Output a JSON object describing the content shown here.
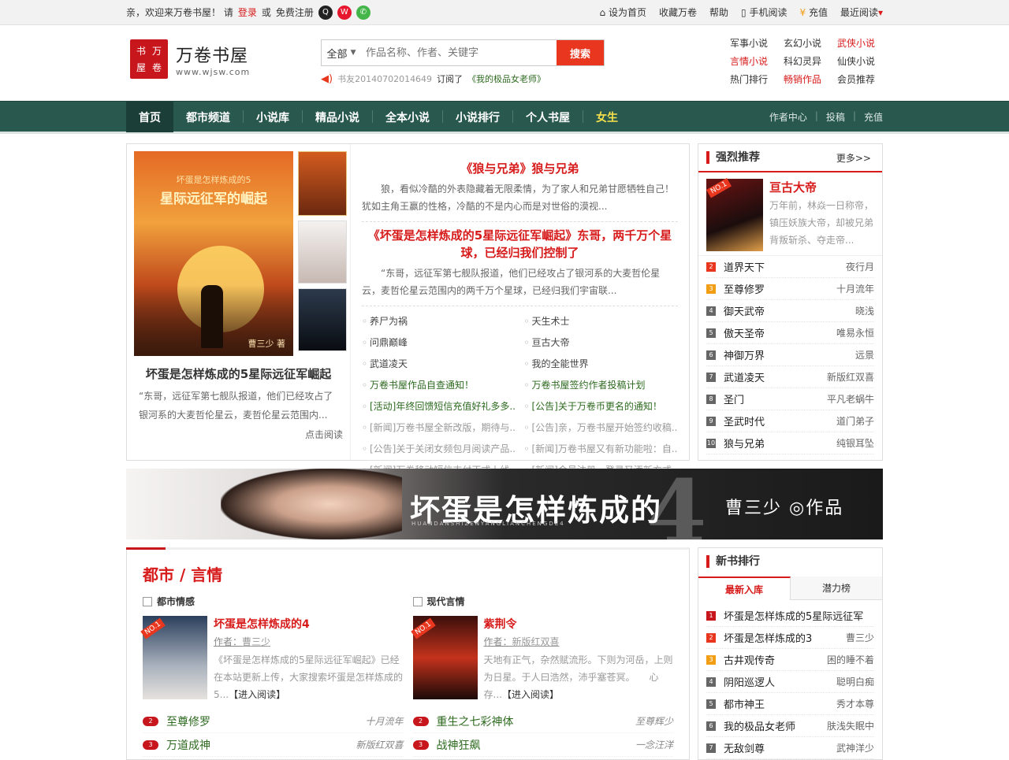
{
  "topbar": {
    "welcome": "亲，欢迎来万卷书屋！ 请",
    "login": "登录",
    "or": "或",
    "register": "免费注册",
    "set_home": "设为首页",
    "bookmark": "收藏万卷",
    "help": "帮助",
    "mobile": "手机阅读",
    "recharge": "充值",
    "recent": "最近阅读"
  },
  "logo": {
    "seal_chars": [
      "书",
      "万",
      "屋",
      "卷"
    ],
    "name": "万卷书屋",
    "url": "www.wjsw.com"
  },
  "search": {
    "category": "全部",
    "placeholder": "作品名称、作者、关键字",
    "button": "搜索"
  },
  "news_line": {
    "user": "书友20140702014649",
    "action": "订阅了",
    "book": "《我的极品女老师》"
  },
  "hot_links": [
    {
      "label": "军事小说",
      "red": false
    },
    {
      "label": "玄幻小说",
      "red": false
    },
    {
      "label": "武侠小说",
      "red": true
    },
    {
      "label": "言情小说",
      "red": true
    },
    {
      "label": "科幻灵异",
      "red": false
    },
    {
      "label": "仙侠小说",
      "red": false
    },
    {
      "label": "热门排行",
      "red": false
    },
    {
      "label": "畅销作品",
      "red": true
    },
    {
      "label": "会员推荐",
      "red": false
    }
  ],
  "nav": {
    "items": [
      "首页",
      "都市频道",
      "小说库",
      "精品小说",
      "全本小说",
      "小说排行",
      "个人书屋",
      "女生"
    ],
    "right": [
      "作者中心",
      "投稿",
      "充值"
    ]
  },
  "feature": {
    "cover_small": "坏蛋是怎样炼成的5",
    "cover_title": "星际远征军的崛起",
    "cover_author": "曹三少 著",
    "title": "坏蛋是怎样炼成的5星际远征军崛起",
    "desc": "“东哥，远征军第七舰队报道，他们已经攻占了银河系的大麦哲伦星云，麦哲伦星云范围内...",
    "more": "点击阅读"
  },
  "headlines": [
    {
      "title": "《狼与兄弟》狼与兄弟",
      "desc": "狼，看似冷酷的外表隐藏着无限柔情，为了家人和兄弟甘愿牺牲自己！犹如主角王赢的性格，冷酷的不是内心而是对世俗的漠视..."
    },
    {
      "title": "《坏蛋是怎样炼成的5星际远征军崛起》东哥，两千万个星球，已经归我们控制了",
      "desc": "“东哥，远征军第七舰队报道，他们已经攻占了银河系的大麦哲伦星云，麦哲伦星云范围内的两千万个星球，已经归我们宇宙联..."
    }
  ],
  "links": [
    {
      "text": "养尸为祸",
      "style": ""
    },
    {
      "text": "天生术士",
      "style": ""
    },
    {
      "text": "问鼎巅峰",
      "style": ""
    },
    {
      "text": "亘古大帝",
      "style": ""
    },
    {
      "text": "武道凌天",
      "style": ""
    },
    {
      "text": "我的全能世界",
      "style": ""
    },
    {
      "text": "万卷书屋作品自查通知！",
      "style": "g"
    },
    {
      "text": "万卷书屋签约作者投稿计划",
      "style": "g"
    },
    {
      "text": "[活动]年终回馈短信充值好礼多多...",
      "style": "g"
    },
    {
      "text": "[公告]关于万卷币更名的通知！",
      "style": "g"
    },
    {
      "text": "[新闻]万卷书屋全新改版，期待与...",
      "style": "gray"
    },
    {
      "text": "[公告]亲，万卷书屋开始签约收稿...",
      "style": "gray"
    },
    {
      "text": "[公告]关于关闭女频包月阅读产品...",
      "style": "gray"
    },
    {
      "text": "[新闻]万卷书屋又有新功能啦：自...",
      "style": "gray"
    },
    {
      "text": "[新闻]万卷移动短信支付正式上线...",
      "style": "gray"
    },
    {
      "text": "[新闻]会员注册、登录又添新方式...",
      "style": "gray"
    }
  ],
  "recommend": {
    "title": "强烈推荐",
    "more": "更多>>",
    "top1": {
      "badge": "NO.1",
      "name": "亘古大帝",
      "desc": "万年前，林焱一日称帝，镇压妖族大帝，却被兄弟背叛斩杀、夺走帝..."
    },
    "list": [
      {
        "num": "2",
        "name": "道界天下",
        "author": "夜行月"
      },
      {
        "num": "3",
        "name": "至尊修罗",
        "author": "十月流年"
      },
      {
        "num": "4",
        "name": "御天武帝",
        "author": "晓浅"
      },
      {
        "num": "5",
        "name": "傲天圣帝",
        "author": "唯易永恒"
      },
      {
        "num": "6",
        "name": "神御万界",
        "author": "远景"
      },
      {
        "num": "7",
        "name": "武道凌天",
        "author": "新版红双喜"
      },
      {
        "num": "8",
        "name": "圣门",
        "author": "平凡老蜗牛"
      },
      {
        "num": "9",
        "name": "圣武时代",
        "author": "道门弟子"
      },
      {
        "num": "10",
        "name": "狼与兄弟",
        "author": "纯银耳坠"
      }
    ]
  },
  "banner": {
    "title": "坏蛋是怎样炼成的",
    "num": "4",
    "sub": "HUANDANSHIZENYANGLIANCHENGDE4",
    "author": "曹三少 ◎作品"
  },
  "category": {
    "title": "都市 / 言情",
    "cols": [
      {
        "head": "都市情感",
        "badge": "NO.1",
        "name": "坏蛋是怎样炼成的4",
        "author_label": "作者：",
        "author": "曹三少",
        "desc": "《坏蛋是怎样炼成的5星际远征军崛起》已经在本站更新上传，大家搜索坏蛋是怎样炼成的5...",
        "read": "【进入阅读】",
        "list": [
          {
            "num": "2",
            "name": "至尊修罗",
            "author": "十月流年"
          },
          {
            "num": "3",
            "name": "万道成神",
            "author": "新版红双喜"
          }
        ]
      },
      {
        "head": "现代言情",
        "badge": "NO.1",
        "name": "紫荆令",
        "author_label": "作者：",
        "author": "新版红双喜",
        "desc": "天地有正气，杂然赋流形。下则为河岳，上则为日星。于人曰浩然，沛乎塞苍冥。　　心存...",
        "read": "【进入阅读】",
        "list": [
          {
            "num": "2",
            "name": "重生之七彩神体",
            "author": "至尊辉少"
          },
          {
            "num": "3",
            "name": "战神狂飙",
            "author": "一念汪洋"
          }
        ]
      }
    ]
  },
  "newrank": {
    "title": "新书排行",
    "tabs": [
      "最新入库",
      "潜力榜"
    ],
    "list": [
      {
        "num": "1",
        "name": "坏蛋是怎样炼成的5星际远征军",
        "author": ""
      },
      {
        "num": "2",
        "name": "坏蛋是怎样炼成的3",
        "author": "曹三少"
      },
      {
        "num": "3",
        "name": "古井观传奇",
        "author": "困的睡不着"
      },
      {
        "num": "4",
        "name": "阴阳巡逻人",
        "author": "聪明白痴"
      },
      {
        "num": "5",
        "name": "都市神王",
        "author": "秀才本尊"
      },
      {
        "num": "6",
        "name": "我的极品女老师",
        "author": "肤浅失眠中"
      },
      {
        "num": "7",
        "name": "无敌剑尊",
        "author": "武神洋少"
      }
    ]
  }
}
